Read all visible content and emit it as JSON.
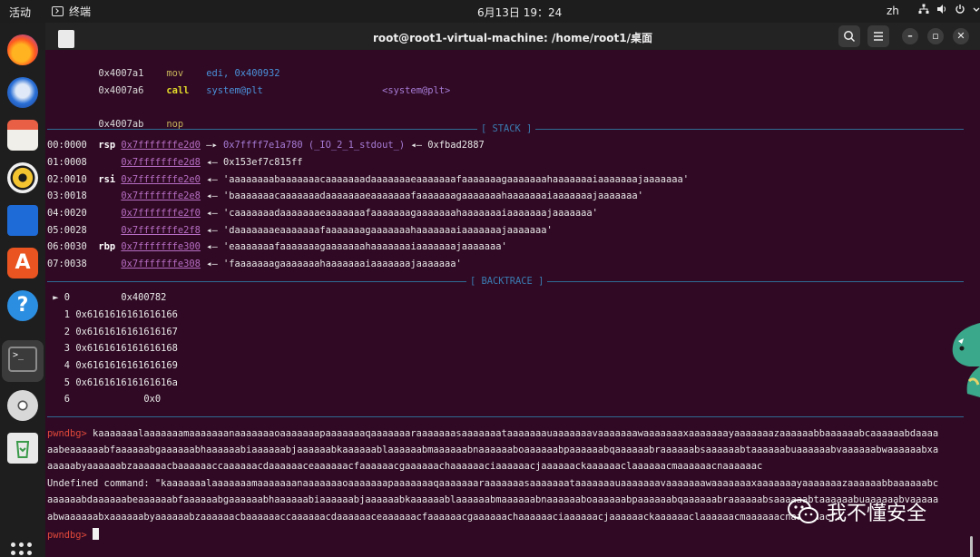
{
  "topbar": {
    "activities": "活动",
    "app_name": "终端",
    "clock": "6月13日  19：24",
    "input_method": "zh"
  },
  "window": {
    "title": "root@root1-virtual-machine: /home/root1/桌面"
  },
  "disasm": [
    {
      "addr": "0x4007a1",
      "mnemonic": "mov",
      "operands": "edi, 0x400932",
      "comment": ""
    },
    {
      "addr": "0x4007a6",
      "mnemonic": "call",
      "operands": "system@plt",
      "comment": "<system@plt>"
    },
    {
      "addr": "0x4007ab",
      "mnemonic": "nop",
      "operands": "",
      "comment": ""
    }
  ],
  "stack_header": "[ STACK ]",
  "stack": [
    {
      "idx": "00:0000",
      "reg": "rsp",
      "addr": "0x7fffffffe2d0",
      "arrow": "—▸",
      "val": "0x7ffff7e1a780 (_IO_2_1_stdout_)",
      "tail": "◂— 0xfbad2887"
    },
    {
      "idx": "01:0008",
      "reg": "",
      "addr": "0x7fffffffe2d8",
      "arrow": "◂—",
      "val": "0x153ef7c815ff",
      "tail": ""
    },
    {
      "idx": "02:0010",
      "reg": "rsi",
      "addr": "0x7fffffffe2e0",
      "arrow": "◂—",
      "val": "'aaaaaaaabaaaaaaacaaaaaaadaaaaaaaeaaaaaaafaaaaaaagaaaaaaahaaaaaaaiaaaaaaajaaaaaaa'",
      "tail": ""
    },
    {
      "idx": "03:0018",
      "reg": "",
      "addr": "0x7fffffffe2e8",
      "arrow": "◂—",
      "val": "'baaaaaaacaaaaaaadaaaaaaaeaaaaaaafaaaaaaagaaaaaaahaaaaaaaiaaaaaaajaaaaaaa'",
      "tail": ""
    },
    {
      "idx": "04:0020",
      "reg": "",
      "addr": "0x7fffffffe2f0",
      "arrow": "◂—",
      "val": "'caaaaaaadaaaaaaaeaaaaaaafaaaaaaagaaaaaaahaaaaaaaiaaaaaaajaaaaaaa'",
      "tail": ""
    },
    {
      "idx": "05:0028",
      "reg": "",
      "addr": "0x7fffffffe2f8",
      "arrow": "◂—",
      "val": "'daaaaaaaeaaaaaaafaaaaaaagaaaaaaahaaaaaaaiaaaaaaajaaaaaaa'",
      "tail": ""
    },
    {
      "idx": "06:0030",
      "reg": "rbp",
      "addr": "0x7fffffffe300",
      "arrow": "◂—",
      "val": "'eaaaaaaafaaaaaaagaaaaaaahaaaaaaaiaaaaaaajaaaaaaa'",
      "tail": ""
    },
    {
      "idx": "07:0038",
      "reg": "",
      "addr": "0x7fffffffe308",
      "arrow": "◂—",
      "val": "'faaaaaaagaaaaaaahaaaaaaaiaaaaaaajaaaaaaa'",
      "tail": ""
    }
  ],
  "backtrace_header": "[ BACKTRACE ]",
  "backtrace": [
    {
      "marker": "►",
      "n": "0",
      "addr": "0x400782"
    },
    {
      "marker": "",
      "n": "1",
      "addr": "0x6161616161616166"
    },
    {
      "marker": "",
      "n": "2",
      "addr": "0x6161616161616167"
    },
    {
      "marker": "",
      "n": "3",
      "addr": "0x6161616161616168"
    },
    {
      "marker": "",
      "n": "4",
      "addr": "0x6161616161616169"
    },
    {
      "marker": "",
      "n": "5",
      "addr": "0x616161616161616a"
    },
    {
      "marker": "",
      "n": "6",
      "addr": "0x0"
    }
  ],
  "prompt": "pwndbg>",
  "input_line1": " kaaaaaaalaaaaaaamaaaaaaanaaaaaaaoaaaaaaapaaaaaaaqaaaaaaaraaaaaaasaaaaaaataaaaaaauaaaaaaavaaaaaaawaaaaaaaxaaaaaaayaaaaaaazaaaaaabbaaaaaabcaaaaaabdaaaa",
  "input_line2": "aabeaaaaaabfaaaaaabgaaaaaabhaaaaaabiaaaaaabjaaaaaabkaaaaaablaaaaaabmaaaaaabnaaaaaaboaaaaaabpaaaaaabqaaaaaabraaaaaabsaaaaaabtaaaaaabuaaaaaabvaaaaaabwaaaaaabxa",
  "input_line3": "aaaaabyaaaaaabzaaaaaacbaaaaaaccaaaaaacdaaaaaaceaaaaaacfaaaaaacgaaaaaachaaaaaaciaaaaaacjaaaaaackaaaaaaclaaaaaacmaaaaaacnaaaaaac",
  "err_line1": "Undefined command: \"kaaaaaaalaaaaaaamaaaaaaanaaaaaaaoaaaaaaapaaaaaaaqaaaaaaaraaaaaaasaaaaaaataaaaaaauaaaaaaavaaaaaaawaaaaaaaxaaaaaaayaaaaaaazaaaaaabbaaaaaabc",
  "err_line2": "aaaaaabdaaaaaabeaaaaaabfaaaaaabgaaaaaabhaaaaaabiaaaaaabjaaaaaabkaaaaaablaaaaaabmaaaaaabnaaaaaaboaaaaaabpaaaaaabqaaaaaabraaaaaabsaaaaaabtaaaaaabuaaaaaabvaaaaa",
  "err_line3": "abwaaaaaabxaaaaaabyaaaaaabzaaaaaacbaaaaaaccaaaaaacdaaaaaaceaaaaaacfaaaaaacgaaaaaachaaaaaaciaaaaaacjaaaaaackaaaaaaclaaaaaacmaaaaaacnaaaaaac\".",
  "watermark": "我不懂安全"
}
